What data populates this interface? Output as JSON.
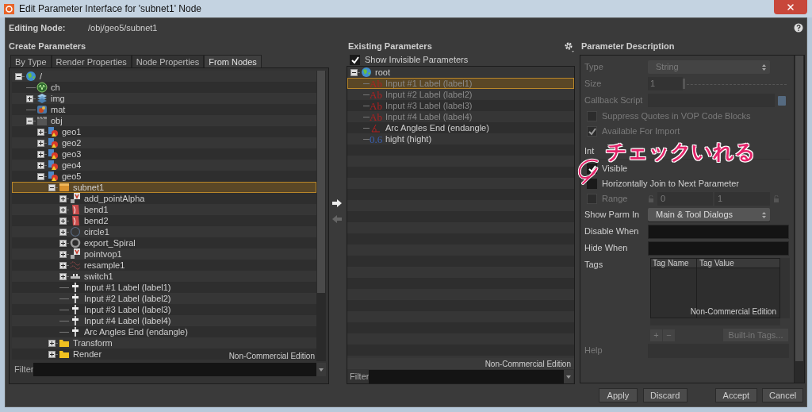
{
  "window": {
    "title": "Edit Parameter Interface for 'subnet1' Node",
    "editing_node_label": "Editing Node:",
    "editing_node_path": "/obj/geo5/subnet1"
  },
  "create_parameters": {
    "title": "Create Parameters",
    "tabs": [
      {
        "label": "By Type",
        "selected": false
      },
      {
        "label": "Render Properties",
        "selected": false
      },
      {
        "label": "Node Properties",
        "selected": false
      },
      {
        "label": "From Nodes",
        "selected": true
      }
    ],
    "tree": [
      {
        "label": "/",
        "kind": "globe",
        "selected": false,
        "expanded": true,
        "children": [
          {
            "label": "ch",
            "kind": "channel",
            "selected": false
          },
          {
            "label": "img",
            "kind": "layers",
            "selected": false,
            "expanded": false
          },
          {
            "label": "mat",
            "kind": "material",
            "selected": false
          },
          {
            "label": "obj",
            "kind": "objects",
            "selected": false,
            "expanded": true,
            "children": [
              {
                "label": "geo1",
                "kind": "geometry",
                "selected": false,
                "expanded": false
              },
              {
                "label": "geo2",
                "kind": "geometry",
                "selected": false,
                "expanded": false
              },
              {
                "label": "geo3",
                "kind": "geometry",
                "selected": false,
                "expanded": false
              },
              {
                "label": "geo4",
                "kind": "geometry",
                "selected": false,
                "expanded": false
              },
              {
                "label": "geo5",
                "kind": "geometry",
                "selected": false,
                "expanded": true,
                "children": [
                  {
                    "label": "subnet1",
                    "kind": "subnet",
                    "selected": true,
                    "expanded": true,
                    "children": [
                      {
                        "label": "add_pointAlpha",
                        "kind": "vop",
                        "selected": false,
                        "expanded": false
                      },
                      {
                        "label": "bend1",
                        "kind": "bend",
                        "selected": false,
                        "expanded": false
                      },
                      {
                        "label": "bend2",
                        "kind": "bend",
                        "selected": false,
                        "expanded": false
                      },
                      {
                        "label": "circle1",
                        "kind": "circle",
                        "selected": false,
                        "expanded": false
                      },
                      {
                        "label": "export_Spiral",
                        "kind": "ring",
                        "selected": false,
                        "expanded": false
                      },
                      {
                        "label": "pointvop1",
                        "kind": "vop",
                        "selected": false,
                        "expanded": false
                      },
                      {
                        "label": "resample1",
                        "kind": "resample",
                        "selected": false,
                        "expanded": false
                      },
                      {
                        "label": "switch1",
                        "kind": "switch",
                        "selected": false,
                        "expanded": false
                      },
                      {
                        "label": "Input #1 Label (label1)",
                        "kind": "parm",
                        "selected": false
                      },
                      {
                        "label": "Input #2 Label (label2)",
                        "kind": "parm",
                        "selected": false
                      },
                      {
                        "label": "Input #3 Label (label3)",
                        "kind": "parm",
                        "selected": false
                      },
                      {
                        "label": "Input #4 Label (label4)",
                        "kind": "parm",
                        "selected": false
                      },
                      {
                        "label": "Arc Angles End (endangle)",
                        "kind": "parm",
                        "selected": false
                      }
                    ]
                  },
                  {
                    "label": "Transform",
                    "kind": "folder",
                    "selected": false,
                    "expanded": false
                  },
                  {
                    "label": "Render",
                    "kind": "folder",
                    "selected": false,
                    "expanded": false
                  }
                ]
              }
            ]
          }
        ]
      }
    ],
    "edition_text": "Non-Commercial Edition",
    "filter_label": "Filter"
  },
  "existing_parameters": {
    "title": "Existing Parameters",
    "show_invisible": {
      "label": "Show Invisible Parameters",
      "checked": true
    },
    "root": {
      "label": "root",
      "expanded": true
    },
    "items": [
      {
        "label": "Input #1 Label (label1)",
        "kind": "string",
        "glyph": "Ab",
        "invisible": true,
        "selected": true
      },
      {
        "label": "Input #2 Label (label2)",
        "kind": "string",
        "glyph": "Ab",
        "invisible": true,
        "selected": false
      },
      {
        "label": "Input #3 Label (label3)",
        "kind": "string",
        "glyph": "Ab",
        "invisible": true,
        "selected": false
      },
      {
        "label": "Input #4 Label (label4)",
        "kind": "string",
        "glyph": "Ab",
        "invisible": true,
        "selected": false
      },
      {
        "label": "Arc Angles End (endangle)",
        "kind": "angle",
        "invisible": false,
        "selected": false
      },
      {
        "label": "hight (hight)",
        "kind": "float",
        "glyph": "0.6",
        "invisible": false,
        "selected": false
      }
    ],
    "edition_text": "Non-Commercial Edition",
    "filter_label": "Filter"
  },
  "parameter_description": {
    "title": "Parameter Description",
    "rows": [
      {
        "kind": "dropdown",
        "label": "Type",
        "value": "String",
        "disabled": true
      },
      {
        "kind": "slider",
        "label": "Size",
        "value": "1",
        "level": 0,
        "disabled": true
      },
      {
        "kind": "script",
        "label": "Callback Script",
        "disabled": true
      },
      {
        "kind": "checkbox",
        "label": "Suppress Quotes in VOP Code Blocks",
        "checked": false,
        "disabled": true
      },
      {
        "kind": "checkbox",
        "label": "Available For Import",
        "checked": true,
        "disabled": true
      },
      {
        "kind": "section",
        "label": "Int"
      },
      {
        "kind": "checkbox",
        "label": "Visible",
        "checked": true,
        "disabled": false
      },
      {
        "kind": "checkbox",
        "label": "Horizontally Join to Next Parameter",
        "checked": false,
        "disabled": false
      },
      {
        "kind": "range",
        "label": "Range",
        "checked": false,
        "disabled": true,
        "min": "0",
        "max": "1"
      },
      {
        "kind": "dropdown",
        "label": "Show Parm In",
        "value": "Main & Tool Dialogs",
        "disabled": false
      },
      {
        "kind": "text",
        "label": "Disable When",
        "disabled": false
      },
      {
        "kind": "text",
        "label": "Hide When",
        "disabled": false
      },
      {
        "kind": "tags",
        "label": "Tags",
        "columns": [
          "Tag Name",
          "Tag Value"
        ],
        "edition_text": "Non-Commercial Edition",
        "add": "+",
        "remove": "−",
        "builtin": "Built-in Tags..."
      },
      {
        "kind": "text",
        "label": "Help",
        "disabled": true
      }
    ]
  },
  "buttons": [
    "Apply",
    "Discard",
    "Accept",
    "Cancel"
  ],
  "annotation": {
    "text": "チェックいれる"
  }
}
